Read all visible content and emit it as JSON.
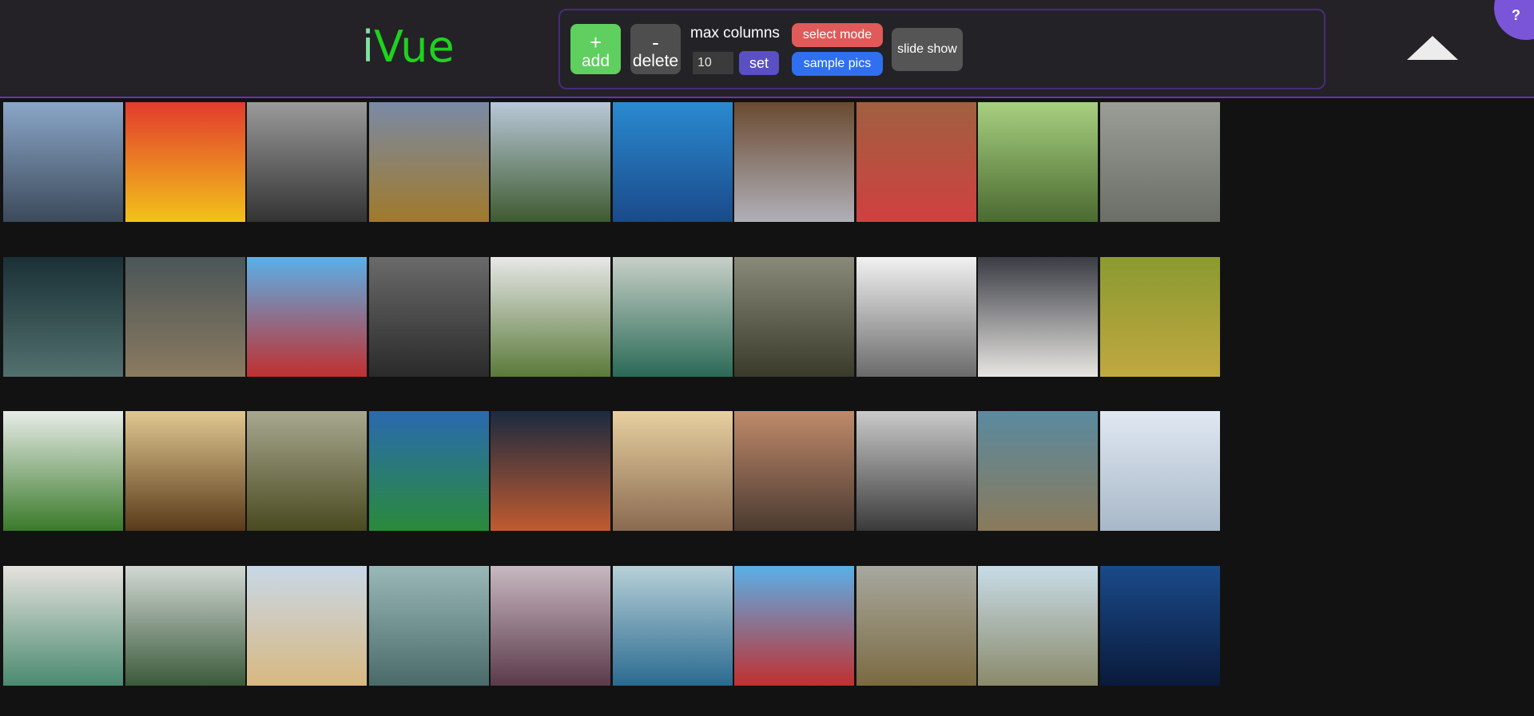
{
  "app": {
    "logo_i": "i",
    "logo_rest": "Vue"
  },
  "toolbar": {
    "add_symbol": "+",
    "add_label": "add",
    "delete_symbol": "-",
    "delete_label": "delete",
    "max_columns_label": "max columns",
    "max_columns_value": "10",
    "set_label": "set",
    "select_mode_label": "select mode",
    "sample_pics_label": "sample pics",
    "slide_show_label": "slide show"
  },
  "help": {
    "label": "?"
  },
  "colors": {
    "accent_purple": "#6a32b8",
    "add_green": "#5fcf5f",
    "select_red": "#e05a5a",
    "sample_blue": "#2f6ff0",
    "set_purple": "#5a50c4"
  },
  "gallery": {
    "columns": 10,
    "images": [
      {
        "name": "man-by-lake",
        "c1": "#8aa6c8",
        "c2": "#3c4a5a"
      },
      {
        "name": "red-yellow-stripes",
        "c1": "#e23b2e",
        "c2": "#f2c21a"
      },
      {
        "name": "cyclists-blur",
        "c1": "#9a9a9a",
        "c2": "#333333"
      },
      {
        "name": "field-horizon",
        "c1": "#7a8aa6",
        "c2": "#a07a2a"
      },
      {
        "name": "mountain-road-tunnel",
        "c1": "#b8c8d8",
        "c2": "#3f5a30"
      },
      {
        "name": "sea-cave",
        "c1": "#2a8ad0",
        "c2": "#1a4a8a"
      },
      {
        "name": "laptop-phone",
        "c1": "#6a4a30",
        "c2": "#b0b0b8"
      },
      {
        "name": "desk-stickers",
        "c1": "#a06040",
        "c2": "#d04040"
      },
      {
        "name": "frog-in-algae",
        "c1": "#a8d080",
        "c2": "#4a6a30"
      },
      {
        "name": "foggy-coast",
        "c1": "#9a9e96",
        "c2": "#6a6e66"
      },
      {
        "name": "city-night-reflection",
        "c1": "#1a3036",
        "c2": "#52706e"
      },
      {
        "name": "stormy-beach",
        "c1": "#4a5658",
        "c2": "#8a7a60"
      },
      {
        "name": "american-flag",
        "c1": "#5ab0e8",
        "c2": "#c03030"
      },
      {
        "name": "flatlay-accessories",
        "c1": "#6a6a6a",
        "c2": "#2a2a2a"
      },
      {
        "name": "snowy-green-hill",
        "c1": "#e8e8e8",
        "c2": "#5a7a3a"
      },
      {
        "name": "canoe-on-lake",
        "c1": "#c8d0c8",
        "c2": "#2a6a56"
      },
      {
        "name": "rocky-river",
        "c1": "#8a8a7a",
        "c2": "#3a3a2a"
      },
      {
        "name": "misty-sea",
        "c1": "#f2f2f2",
        "c2": "#6a6a6a"
      },
      {
        "name": "desk-keyboard",
        "c1": "#3a3c44",
        "c2": "#e8e6e2"
      },
      {
        "name": "green-forest-moss",
        "c1": "#8a9a30",
        "c2": "#c0a840"
      },
      {
        "name": "succulent-terrarium",
        "c1": "#e8ece8",
        "c2": "#3a7a2a"
      },
      {
        "name": "wooden-dome",
        "c1": "#e0c890",
        "c2": "#5a3a1a"
      },
      {
        "name": "green-valley-sky",
        "c1": "#a8a890",
        "c2": "#4a4a20"
      },
      {
        "name": "stadium-crowd",
        "c1": "#2a6ab0",
        "c2": "#2a8a3a"
      },
      {
        "name": "night-sky-rock",
        "c1": "#1a2a40",
        "c2": "#c05a30"
      },
      {
        "name": "european-town",
        "c1": "#e8d0a0",
        "c2": "#8a6a50"
      },
      {
        "name": "sunrise-fog",
        "c1": "#c08a6a",
        "c2": "#4a3a30"
      },
      {
        "name": "church-interior",
        "c1": "#cacaca",
        "c2": "#3a3a3a"
      },
      {
        "name": "aerial-highway",
        "c1": "#5a8aa0",
        "c2": "#8a7a5a"
      },
      {
        "name": "frosted-plants",
        "c1": "#e0e8f2",
        "c2": "#a8b8c8"
      },
      {
        "name": "cup-on-bed",
        "c1": "#e6e2de",
        "c2": "#4a8a70"
      },
      {
        "name": "foggy-trees",
        "c1": "#d2d8d4",
        "c2": "#3a5a3a"
      },
      {
        "name": "white-building-sea",
        "c1": "#c8d8e8",
        "c2": "#d8b880"
      },
      {
        "name": "paper-on-table",
        "c1": "#9ab8b8",
        "c2": "#4a6a6a"
      },
      {
        "name": "purple-misty-trees",
        "c1": "#c8b8c0",
        "c2": "#5a3a4a"
      },
      {
        "name": "rocky-shore-sea",
        "c1": "#b8d0d8",
        "c2": "#2a6a90"
      },
      {
        "name": "american-flag-2",
        "c1": "#5ab0e8",
        "c2": "#c03030"
      },
      {
        "name": "old-truck",
        "c1": "#a8a8a0",
        "c2": "#7a6a40"
      },
      {
        "name": "boardwalk-beach",
        "c1": "#c8dce8",
        "c2": "#8a8a6a"
      },
      {
        "name": "blue-wave",
        "c1": "#1a4a8a",
        "c2": "#0a1a3a"
      }
    ]
  }
}
